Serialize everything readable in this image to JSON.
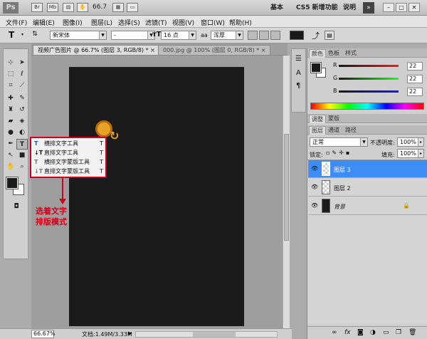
{
  "titlebar": {
    "app_logo": "Ps",
    "icon_br": "Br",
    "icon_mb": "Mb",
    "zoom": "66.7",
    "workspaces": [
      "基本",
      "CS5 新增功能",
      "说明"
    ]
  },
  "menu": [
    "文件(F)",
    "编辑(E)",
    "图像(I)",
    "图层(L)",
    "选择(S)",
    "滤镜(T)",
    "视图(V)",
    "窗口(W)",
    "帮助(H)"
  ],
  "options": {
    "tool_icon": "T",
    "font_family": "新宋体",
    "font_style": "-",
    "font_size": "16 点",
    "antialias_icon": "aa",
    "antialias": "浑厚"
  },
  "document": {
    "tabs": [
      "视频广告图片 @ 66.7% (图层 3, RGB/8) *",
      "000.jpg @ 100% (图层 0, RGB/8) *"
    ],
    "zoom_status": "66.67%",
    "doc_status": "文档:1.49M/3.33M",
    "canvas_color": "#1b1b1b"
  },
  "flyout": {
    "items": [
      {
        "label": "横排文字工具",
        "key": "T",
        "icon": "T"
      },
      {
        "label": "直排文字工具",
        "key": "T",
        "icon": "↓T"
      },
      {
        "label": "横排文字蒙版工具",
        "key": "T",
        "icon": "T"
      },
      {
        "label": "直排文字蒙版工具",
        "key": "T",
        "icon": "↓T"
      }
    ],
    "border_color": "#d0021b"
  },
  "annotation": {
    "line1": "选着文字",
    "line2": "排版模式"
  },
  "color_panel": {
    "tabs": [
      "颜色",
      "色板",
      "样式"
    ],
    "sliders": [
      {
        "label": "R",
        "value": "22"
      },
      {
        "label": "G",
        "value": "22"
      },
      {
        "label": "B",
        "value": "22"
      }
    ]
  },
  "adjust_tabs": [
    "调整",
    "蒙版"
  ],
  "layers_panel": {
    "tabs": [
      "图层",
      "通道",
      "路径"
    ],
    "blend_mode": "正常",
    "opacity_label": "不透明度:",
    "opacity": "100%",
    "lock_label": "锁定:",
    "fill_label": "填充:",
    "fill": "100%",
    "layers": [
      {
        "name": "图层 3",
        "selected": true
      },
      {
        "name": "图层 2",
        "selected": false
      },
      {
        "name": "背景",
        "selected": false
      }
    ]
  }
}
